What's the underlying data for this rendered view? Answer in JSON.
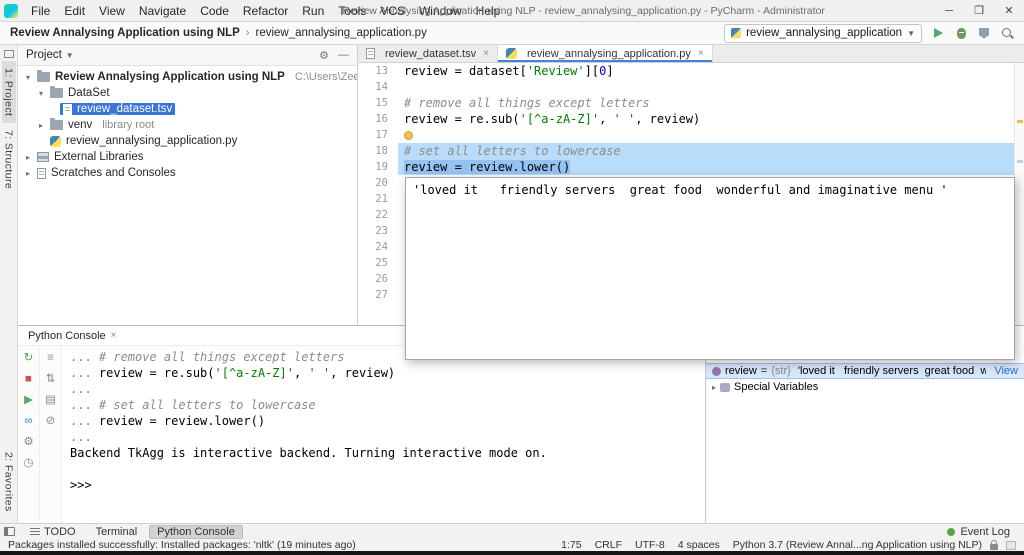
{
  "title_bar": {
    "title": "Review Annalysing Application using NLP - review_annalysing_application.py - PyCharm - Administrator",
    "menus": [
      "File",
      "Edit",
      "View",
      "Navigate",
      "Code",
      "Refactor",
      "Run",
      "Tools",
      "VCS",
      "Window",
      "Help"
    ],
    "window_controls": {
      "minimize": "─",
      "maximize": "❒",
      "close": "✕"
    }
  },
  "toolbar": {
    "breadcrumbs": [
      {
        "label": "Review Annalysing Application using NLP"
      },
      {
        "label": "review_annalysing_application.py"
      }
    ],
    "run_config": "review_annalysing_application",
    "actions": [
      {
        "name": "run-button",
        "type": "play"
      },
      {
        "name": "debug-button",
        "type": "bug"
      },
      {
        "name": "coverage-button",
        "type": "coverage"
      },
      {
        "name": "search-everywhere-button",
        "type": "search"
      }
    ]
  },
  "tool_strip": {
    "top": [
      {
        "label": "1: Project",
        "active": true
      },
      {
        "label": "7: Structure",
        "active": false
      }
    ],
    "bottom": [
      {
        "label": "2: Favorites",
        "active": false
      }
    ]
  },
  "project_panel": {
    "title": "Project",
    "tools": [
      {
        "name": "settings-gear-icon",
        "glyph": "⚙"
      },
      {
        "name": "hide-panel-icon",
        "glyph": "—"
      }
    ],
    "tree": [
      {
        "label": "Review Annalysing Application using NLP",
        "hint": "C:\\Users\\ZeeLot\\PycharmProjects\\",
        "icon": "folder",
        "chevron": "▾",
        "indent": 0,
        "bold": true
      },
      {
        "label": "DataSet",
        "icon": "folder",
        "chevron": "▾",
        "indent": 1
      },
      {
        "label": "review_dataset.tsv",
        "icon": "tsv-file",
        "chevron": "",
        "indent": 2,
        "selected": true
      },
      {
        "label": "venv",
        "hint": "library root",
        "icon": "folder",
        "chevron": "▸",
        "indent": 1
      },
      {
        "label": "review_annalysing_application.py",
        "icon": "python-file",
        "chevron": "",
        "indent": 1
      },
      {
        "label": "External Libraries",
        "icon": "libraries",
        "chevron": "▸",
        "indent": 0
      },
      {
        "label": "Scratches and Consoles",
        "icon": "scratches",
        "chevron": "▸",
        "indent": 0
      }
    ]
  },
  "editor": {
    "tabs": [
      {
        "label": "review_dataset.tsv",
        "icon": "tsv-file",
        "active": false
      },
      {
        "label": "review_annalysing_application.py",
        "icon": "python-file",
        "active": true
      }
    ],
    "lines": [
      {
        "n": 13,
        "tokens": [
          [
            "code",
            "review = dataset["
          ],
          [
            "str",
            "'Review'"
          ],
          [
            "code",
            "]["
          ],
          [
            "num",
            "0"
          ],
          [
            "code",
            "]"
          ]
        ]
      },
      {
        "n": 14,
        "tokens": []
      },
      {
        "n": 15,
        "tokens": [
          [
            "comment",
            "# remove all things except letters"
          ]
        ]
      },
      {
        "n": 16,
        "tokens": [
          [
            "code",
            "review = re.sub("
          ],
          [
            "str",
            "'[^a-zA-Z]'"
          ],
          [
            "code",
            ", "
          ],
          [
            "str",
            "' '"
          ],
          [
            "code",
            ", review)"
          ]
        ]
      },
      {
        "n": 17,
        "tokens": [],
        "bulb": true
      },
      {
        "n": 18,
        "tokens": [
          [
            "comment",
            "# set all letters to lowercase"
          ]
        ],
        "highlight": true
      },
      {
        "n": 19,
        "tokens": [
          [
            "sel",
            "review = review.lower()"
          ]
        ],
        "highlight": true
      },
      {
        "n": 20,
        "tokens": []
      },
      {
        "n": 21,
        "tokens": []
      },
      {
        "n": 22,
        "tokens": []
      },
      {
        "n": 23,
        "tokens": []
      },
      {
        "n": 24,
        "tokens": []
      },
      {
        "n": 25,
        "tokens": []
      },
      {
        "n": 26,
        "tokens": []
      },
      {
        "n": 27,
        "tokens": []
      }
    ],
    "popup_value": "'loved it   friendly servers  great food  wonderful and imaginative menu '"
  },
  "console": {
    "tab_label": "Python Console",
    "toolbar_primary": [
      {
        "name": "rerun-icon",
        "glyph": "↻",
        "color": "#4fa157"
      },
      {
        "name": "stop-icon",
        "glyph": "■",
        "color": "#c75450"
      },
      {
        "name": "execute-icon",
        "glyph": "▶",
        "color": "#59a869"
      },
      {
        "name": "attach-debugger-icon",
        "glyph": "∞",
        "color": "#3592c4"
      },
      {
        "name": "settings-gear-icon",
        "glyph": "⚙",
        "color": "#7f8b91"
      },
      {
        "name": "history-icon",
        "glyph": "◷",
        "color": "#7f8b91"
      }
    ],
    "toolbar_secondary": [
      {
        "name": "filter-icon",
        "glyph": "≡",
        "color": "#7f8b91"
      },
      {
        "name": "soft-wrap-icon",
        "glyph": "⇅",
        "color": "#7f8b91"
      },
      {
        "name": "print-icon",
        "glyph": "▤",
        "color": "#7f8b91"
      },
      {
        "name": "clear-icon",
        "glyph": "⊘",
        "color": "#7f8b91"
      }
    ],
    "lines": [
      {
        "tokens": [
          [
            "prompt",
            "... "
          ],
          [
            "comment",
            "# remove all things except letters"
          ]
        ]
      },
      {
        "tokens": [
          [
            "prompt",
            "... "
          ],
          [
            "code",
            "review = re.sub("
          ],
          [
            "str",
            "'[^a-zA-Z]'"
          ],
          [
            "code",
            ", "
          ],
          [
            "str",
            "' '"
          ],
          [
            "code",
            ", review)"
          ]
        ]
      },
      {
        "tokens": [
          [
            "prompt",
            "..."
          ]
        ]
      },
      {
        "tokens": [
          [
            "prompt",
            "... "
          ],
          [
            "comment",
            "# set all letters to lowercase"
          ]
        ]
      },
      {
        "tokens": [
          [
            "prompt",
            "... "
          ],
          [
            "code",
            "review = review.lower()"
          ]
        ]
      },
      {
        "tokens": [
          [
            "prompt",
            "..."
          ]
        ]
      },
      {
        "tokens": [
          [
            "output",
            "Backend TkAgg is interactive backend. Turning interactive mode on."
          ]
        ]
      },
      {
        "tokens": []
      },
      {
        "tokens": [
          [
            "code",
            ">>>"
          ]
        ]
      }
    ]
  },
  "variables_panel": {
    "rows": [
      {
        "icon": "variable-icon",
        "name": "review",
        "type": "{str}",
        "value": "'loved it   friendly servers  great food  wonderful and...",
        "action": "View",
        "selected": true
      },
      {
        "icon": "special-variables-icon",
        "name": "Special Variables",
        "chevron": "▸"
      }
    ]
  },
  "tool_window_bar": {
    "items": [
      {
        "label": "TODO",
        "icon": "todo"
      },
      {
        "label": "Terminal"
      },
      {
        "label": "Python Console",
        "active": true
      }
    ],
    "event_log": "Event Log"
  },
  "status_bar": {
    "message": "Packages installed successfully: Installed packages: 'nltk' (19 minutes ago)",
    "items": [
      {
        "name": "caret-position",
        "label": "1:75"
      },
      {
        "name": "line-separator",
        "label": "CRLF"
      },
      {
        "name": "file-encoding",
        "label": "UTF-8"
      },
      {
        "name": "indent-style",
        "label": "4 spaces"
      },
      {
        "name": "python-interpreter",
        "label": "Python 3.7 (Review Annal...ng Application using NLP)"
      }
    ]
  }
}
